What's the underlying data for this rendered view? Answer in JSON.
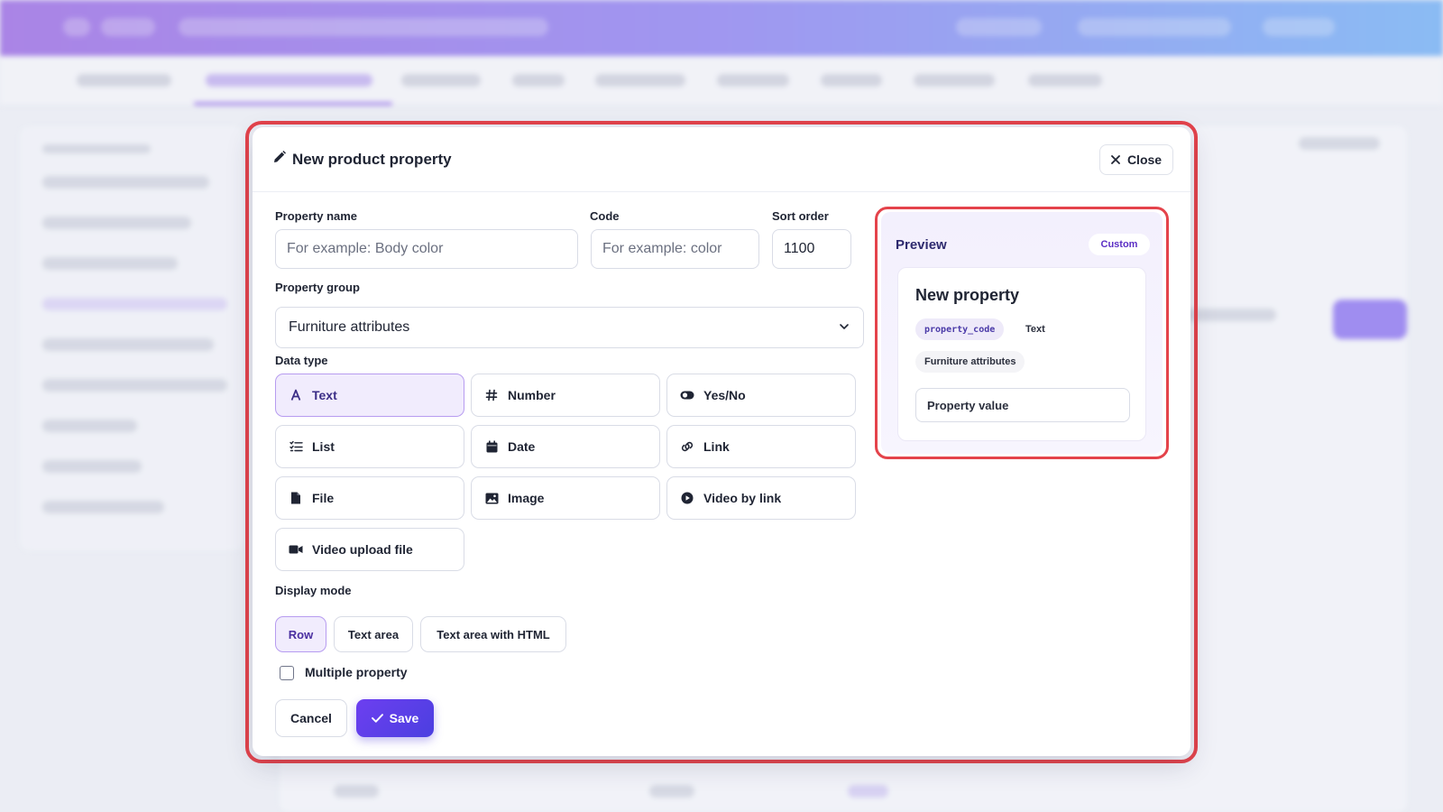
{
  "modal": {
    "title": "New product property",
    "close_label": "Close"
  },
  "form": {
    "property_name": {
      "label": "Property name",
      "placeholder": "For example: Body color",
      "value": ""
    },
    "code": {
      "label": "Code",
      "placeholder": "For example: color",
      "value": ""
    },
    "sort_order": {
      "label": "Sort order",
      "value": "1100"
    },
    "property_group": {
      "label": "Property group",
      "selected": "Furniture attributes"
    },
    "data_type": {
      "label": "Data type",
      "selected": "Text",
      "options": [
        {
          "label": "Text",
          "icon": "text-type-icon"
        },
        {
          "label": "Number",
          "icon": "hash-icon"
        },
        {
          "label": "Yes/No",
          "icon": "toggle-icon"
        },
        {
          "label": "List",
          "icon": "list-icon"
        },
        {
          "label": "Date",
          "icon": "calendar-icon"
        },
        {
          "label": "Link",
          "icon": "link-icon"
        },
        {
          "label": "File",
          "icon": "file-icon"
        },
        {
          "label": "Image",
          "icon": "image-icon"
        },
        {
          "label": "Video by link",
          "icon": "play-icon"
        },
        {
          "label": "Video upload file",
          "icon": "video-camera-icon"
        }
      ]
    },
    "display_mode": {
      "label": "Display mode",
      "selected": "Row",
      "options": [
        "Row",
        "Text area",
        "Text area with HTML"
      ]
    },
    "multiple_property": {
      "label": "Multiple property",
      "checked": false
    },
    "cancel_label": "Cancel",
    "save_label": "Save"
  },
  "preview": {
    "title": "Preview",
    "badge": "Custom",
    "property_name": "New property",
    "code_chip": "property_code",
    "type_chip": "Text",
    "group_chip": "Furniture attributes",
    "value_placeholder": "Property value"
  },
  "colors": {
    "accent": "#5b3ee8",
    "highlight_outline": "#e4434b",
    "header_gradient_start": "#8a4fe0",
    "header_gradient_end": "#5aa4f5"
  }
}
